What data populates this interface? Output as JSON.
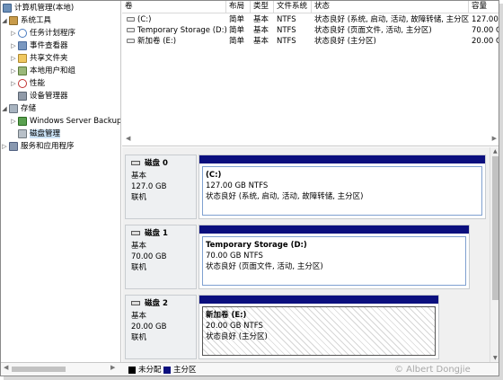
{
  "tree": {
    "root": "计算机管理(本地)",
    "system_tools": "系统工具",
    "task_scheduler": "任务计划程序",
    "event_viewer": "事件查看器",
    "shared_folders": "共享文件夹",
    "local_users": "本地用户和组",
    "performance": "性能",
    "device_manager": "设备管理器",
    "storage": "存储",
    "windows_backup": "Windows Server Backup",
    "disk_management": "磁盘管理",
    "services": "服务和应用程序",
    "expand_glyph": "▷",
    "collapse_glyph": "◢"
  },
  "volume_list": {
    "headers": {
      "volume": "卷",
      "layout": "布局",
      "type": "类型",
      "filesystem": "文件系统",
      "status": "状态",
      "capacity": "容量"
    },
    "rows": [
      {
        "volume": "(C:)",
        "layout": "简单",
        "type": "基本",
        "filesystem": "NTFS",
        "status": "状态良好 (系统, 启动, 活动, 故障转储, 主分区)",
        "capacity": "127.00"
      },
      {
        "volume": "Temporary Storage (D:)",
        "layout": "简单",
        "type": "基本",
        "filesystem": "NTFS",
        "status": "状态良好 (页面文件, 活动, 主分区)",
        "capacity": "70.00 G"
      },
      {
        "volume": "新加卷 (E:)",
        "layout": "简单",
        "type": "基本",
        "filesystem": "NTFS",
        "status": "状态良好 (主分区)",
        "capacity": "20.00 G"
      }
    ]
  },
  "disks": [
    {
      "name": "磁盘 0",
      "kind": "基本",
      "size": "127.0 GB",
      "state": "联机",
      "volume": {
        "title": "(C:)",
        "size": "127.00 GB NTFS",
        "status": "状态良好 (系统, 启动, 活动, 故障转储, 主分区)"
      }
    },
    {
      "name": "磁盘 1",
      "kind": "基本",
      "size": "70.00 GB",
      "state": "联机",
      "volume": {
        "title": "Temporary Storage  (D:)",
        "size": "70.00 GB NTFS",
        "status": "状态良好 (页面文件, 活动, 主分区)"
      }
    },
    {
      "name": "磁盘 2",
      "kind": "基本",
      "size": "20.00 GB",
      "state": "联机",
      "volume": {
        "title": "新加卷  (E:)",
        "size": "20.00 GB NTFS",
        "status": "状态良好 (主分区)"
      }
    }
  ],
  "legend": {
    "unallocated": "未分配",
    "primary": "主分区",
    "unallocated_color": "#000000",
    "primary_color": "#0b0f7e"
  },
  "watermark": "© Albert Dongjie"
}
